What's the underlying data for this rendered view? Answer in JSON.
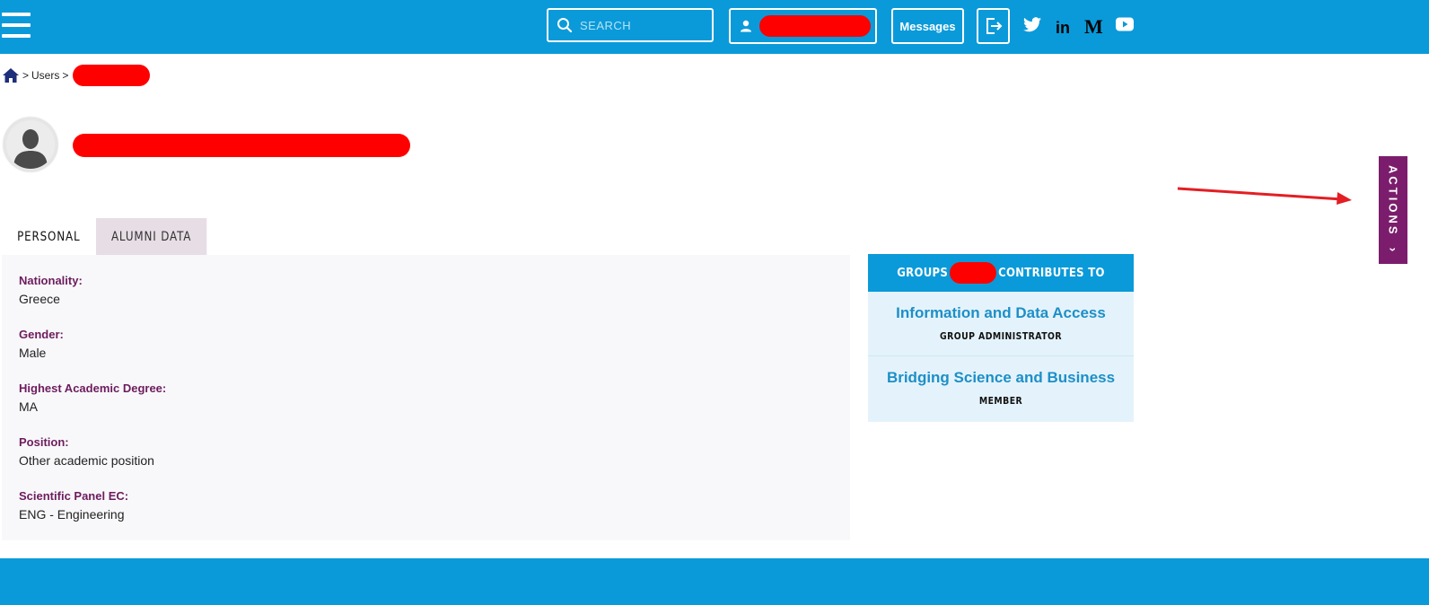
{
  "header": {
    "search_placeholder": "SEARCH",
    "messages_label": "Messages",
    "icons": [
      "menu-icon",
      "search-icon",
      "user-icon",
      "logout-icon",
      "twitter-icon",
      "linkedin-icon",
      "medium-icon",
      "youtube-icon"
    ],
    "linkedin_glyph": "in",
    "medium_glyph": "M"
  },
  "breadcrumb": {
    "home_icon": "home-icon",
    "sep": ">",
    "users_label": "Users"
  },
  "actions": {
    "label": "ACTIONS",
    "chevron": "›"
  },
  "tabs": [
    {
      "label": "PERSONAL",
      "active": true
    },
    {
      "label": "ALUMNI DATA",
      "active": false
    }
  ],
  "personal": {
    "fields": [
      {
        "label": "Nationality:",
        "value": "Greece"
      },
      {
        "label": "Gender:",
        "value": "Male"
      },
      {
        "label": "Highest Academic Degree:",
        "value": "MA"
      },
      {
        "label": "Position:",
        "value": "Other academic position"
      },
      {
        "label": "Scientific Panel EC:",
        "value": "ENG - Engineering"
      }
    ]
  },
  "groups": {
    "header_prefix": "GROUPS",
    "header_suffix": "CONTRIBUTES TO",
    "items": [
      {
        "name": "Information and Data Access",
        "role": "GROUP ADMINISTRATOR"
      },
      {
        "name": "Bridging Science and Business",
        "role": "MEMBER"
      }
    ]
  },
  "colors": {
    "brand_blue": "#0a9ad9",
    "accent_purple": "#7b1d6c",
    "label_purple": "#6d1c5c",
    "redaction": "#ff0000"
  }
}
